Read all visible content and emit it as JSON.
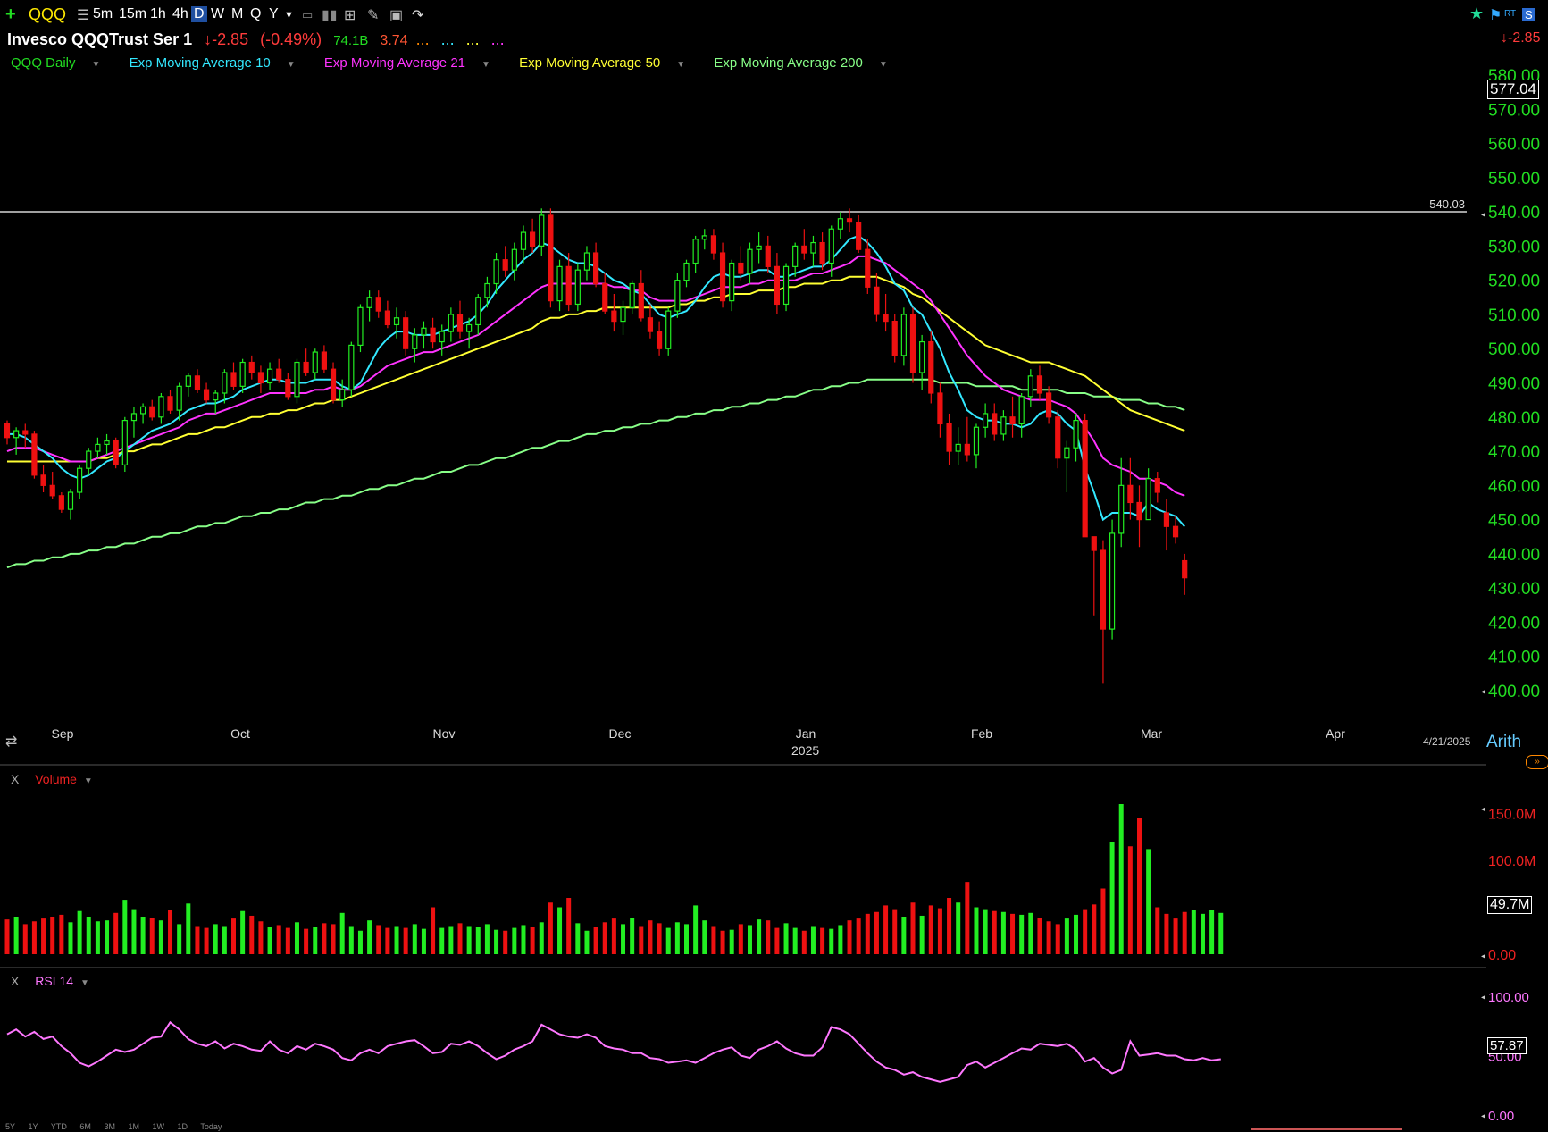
{
  "toolbar": {
    "symbol": "QQQ",
    "intervals": [
      "5m",
      "15m",
      "1h",
      "4h",
      "D",
      "W",
      "M",
      "Q",
      "Y"
    ],
    "active_interval": "D",
    "icons": [
      "add-symbol-icon",
      "list-icon",
      "template-icon",
      "bars-icon",
      "layout-icon",
      "draw-icon",
      "share-icon",
      "redo-icon"
    ],
    "right": {
      "star": "star-icon",
      "flag": "flag-icon",
      "rt": "RT",
      "s": "S"
    }
  },
  "header": {
    "name": "Invesco QQQTrust Ser 1",
    "change": "-2.85",
    "change_pct": "(-0.49%)",
    "mktcap": "74.1B",
    "value2": "3.74",
    "right_change": "-2.85"
  },
  "studies": [
    {
      "label": "QQQ Daily",
      "color": "#22dd22"
    },
    {
      "label": "Exp Moving Average 10",
      "color": "#33e8ff"
    },
    {
      "label": "Exp Moving Average 21",
      "color": "#ff33ff"
    },
    {
      "label": "Exp Moving Average 50",
      "color": "#ffff33"
    },
    {
      "label": "Exp Moving Average 200",
      "color": "#88ff88"
    }
  ],
  "price_axis": {
    "ticks": [
      "580.00",
      "570.00",
      "560.00",
      "550.00",
      "540.00",
      "530.00",
      "520.00",
      "510.00",
      "500.00",
      "490.00",
      "480.00",
      "470.00",
      "460.00",
      "450.00",
      "440.00",
      "430.00",
      "420.00",
      "410.00",
      "400.00"
    ],
    "last_price": "577.04",
    "scale": "Arith",
    "date": "4/21/2025"
  },
  "time_axis": {
    "labels": [
      "Sep",
      "Oct",
      "Nov",
      "Dec",
      "Jan",
      "Feb",
      "Mar",
      "Apr"
    ],
    "year": "2025"
  },
  "hline": {
    "value": 540.03,
    "label": "540.03"
  },
  "volume_panel": {
    "title": "Volume",
    "ticks": [
      "150.0M",
      "100.0M",
      "0.00"
    ],
    "last": "49.7M"
  },
  "rsi_panel": {
    "title": "RSI 14",
    "ticks": [
      "100.00",
      "50.00",
      "0.00"
    ],
    "last": "57.87"
  },
  "close_label": "X",
  "periods": [
    "5Y",
    "1Y",
    "YTD",
    "6M",
    "3M",
    "1M",
    "1W",
    "1D",
    "Today"
  ],
  "chart_data": {
    "type": "candlestick",
    "title": "QQQ Daily",
    "ylim": [
      400,
      580
    ],
    "first_date": "2024-08-26",
    "candles": [
      [
        478,
        479,
        472,
        474
      ],
      [
        474,
        477,
        469,
        476
      ],
      [
        476,
        478,
        471,
        475
      ],
      [
        475,
        476,
        462,
        463
      ],
      [
        463,
        466,
        458,
        460
      ],
      [
        460,
        464,
        456,
        457
      ],
      [
        457,
        458,
        452,
        453
      ],
      [
        453,
        459,
        450,
        458
      ],
      [
        458,
        466,
        456,
        465
      ],
      [
        465,
        471,
        463,
        470
      ],
      [
        470,
        474,
        468,
        472
      ],
      [
        472,
        475,
        469,
        473
      ],
      [
        473,
        474,
        465,
        466
      ],
      [
        466,
        480,
        464,
        479
      ],
      [
        479,
        483,
        474,
        481
      ],
      [
        481,
        484,
        478,
        483
      ],
      [
        483,
        485,
        479,
        480
      ],
      [
        480,
        487,
        478,
        486
      ],
      [
        486,
        488,
        481,
        482
      ],
      [
        482,
        490,
        479,
        489
      ],
      [
        489,
        493,
        486,
        492
      ],
      [
        492,
        494,
        487,
        488
      ],
      [
        488,
        490,
        484,
        485
      ],
      [
        485,
        488,
        481,
        487
      ],
      [
        487,
        494,
        484,
        493
      ],
      [
        493,
        496,
        488,
        489
      ],
      [
        489,
        497,
        487,
        496
      ],
      [
        496,
        498,
        491,
        493
      ],
      [
        493,
        495,
        487,
        490
      ],
      [
        490,
        496,
        488,
        494
      ],
      [
        494,
        497,
        490,
        491
      ],
      [
        491,
        493,
        485,
        486
      ],
      [
        486,
        497,
        484,
        496
      ],
      [
        496,
        500,
        492,
        493
      ],
      [
        493,
        500,
        491,
        499
      ],
      [
        499,
        501,
        493,
        494
      ],
      [
        494,
        496,
        484,
        485
      ],
      [
        485,
        491,
        483,
        488
      ],
      [
        488,
        502,
        486,
        501
      ],
      [
        501,
        513,
        499,
        512
      ],
      [
        512,
        517,
        508,
        515
      ],
      [
        515,
        517,
        509,
        511
      ],
      [
        511,
        514,
        506,
        507
      ],
      [
        507,
        512,
        503,
        509
      ],
      [
        509,
        511,
        498,
        500
      ],
      [
        500,
        506,
        496,
        504
      ],
      [
        504,
        508,
        500,
        506
      ],
      [
        506,
        509,
        500,
        502
      ],
      [
        502,
        507,
        498,
        505
      ],
      [
        505,
        512,
        502,
        510
      ],
      [
        510,
        514,
        503,
        505
      ],
      [
        505,
        509,
        500,
        507
      ],
      [
        507,
        516,
        504,
        515
      ],
      [
        515,
        521,
        512,
        519
      ],
      [
        519,
        528,
        516,
        526
      ],
      [
        526,
        530,
        521,
        523
      ],
      [
        523,
        531,
        520,
        529
      ],
      [
        529,
        536,
        525,
        534
      ],
      [
        534,
        538,
        528,
        530
      ],
      [
        530,
        541,
        527,
        539
      ],
      [
        539,
        541,
        512,
        514
      ],
      [
        514,
        526,
        511,
        524
      ],
      [
        524,
        528,
        511,
        513
      ],
      [
        513,
        525,
        511,
        523
      ],
      [
        523,
        530,
        520,
        528
      ],
      [
        528,
        531,
        518,
        519
      ],
      [
        519,
        522,
        510,
        511
      ],
      [
        511,
        516,
        505,
        508
      ],
      [
        508,
        514,
        504,
        512
      ],
      [
        512,
        520,
        510,
        519
      ],
      [
        519,
        523,
        508,
        509
      ],
      [
        509,
        513,
        503,
        505
      ],
      [
        505,
        508,
        498,
        500
      ],
      [
        500,
        512,
        498,
        511
      ],
      [
        511,
        522,
        509,
        520
      ],
      [
        520,
        526,
        518,
        525
      ],
      [
        525,
        533,
        522,
        532
      ],
      [
        532,
        535,
        529,
        533
      ],
      [
        533,
        535,
        526,
        528
      ],
      [
        528,
        531,
        512,
        514
      ],
      [
        514,
        526,
        511,
        525
      ],
      [
        525,
        530,
        520,
        522
      ],
      [
        522,
        531,
        519,
        529
      ],
      [
        529,
        534,
        525,
        530
      ],
      [
        530,
        533,
        522,
        524
      ],
      [
        524,
        528,
        510,
        513
      ],
      [
        513,
        525,
        511,
        524
      ],
      [
        524,
        531,
        521,
        530
      ],
      [
        530,
        535,
        526,
        528
      ],
      [
        528,
        533,
        524,
        531
      ],
      [
        531,
        534,
        523,
        525
      ],
      [
        525,
        536,
        521,
        535
      ],
      [
        535,
        540,
        532,
        538
      ],
      [
        538,
        541,
        534,
        537
      ],
      [
        537,
        539,
        528,
        529
      ],
      [
        529,
        532,
        516,
        518
      ],
      [
        518,
        522,
        508,
        510
      ],
      [
        510,
        516,
        505,
        508
      ],
      [
        508,
        510,
        496,
        498
      ],
      [
        498,
        512,
        495,
        510
      ],
      [
        510,
        512,
        490,
        493
      ],
      [
        493,
        504,
        488,
        502
      ],
      [
        502,
        505,
        484,
        487
      ],
      [
        487,
        490,
        474,
        478
      ],
      [
        478,
        481,
        466,
        470
      ],
      [
        470,
        477,
        466,
        472
      ],
      [
        472,
        480,
        467,
        469
      ],
      [
        469,
        478,
        465,
        477
      ],
      [
        477,
        484,
        474,
        481
      ],
      [
        481,
        484,
        473,
        475
      ],
      [
        475,
        482,
        473,
        480
      ],
      [
        480,
        486,
        474,
        478
      ],
      [
        478,
        487,
        474,
        486
      ],
      [
        486,
        494,
        483,
        492
      ],
      [
        492,
        495,
        485,
        487
      ],
      [
        487,
        489,
        478,
        480
      ],
      [
        480,
        482,
        465,
        468
      ],
      [
        468,
        473,
        458,
        471
      ],
      [
        471,
        481,
        467,
        479
      ],
      [
        479,
        481,
        460,
        445
      ],
      [
        445,
        441,
        422,
        441
      ],
      [
        441,
        444,
        402,
        418
      ],
      [
        418,
        450,
        415,
        446
      ],
      [
        446,
        468,
        442,
        460
      ],
      [
        460,
        468,
        450,
        455
      ],
      [
        455,
        460,
        442,
        450
      ],
      [
        450,
        465,
        450,
        462
      ],
      [
        462,
        464,
        455,
        458
      ],
      [
        452,
        456,
        441,
        448
      ],
      [
        448,
        451,
        443,
        445
      ],
      [
        438,
        440,
        428,
        433
      ]
    ],
    "volume_ylim": [
      0,
      160
    ],
    "volume": [
      37,
      40,
      32,
      35,
      38,
      40,
      42,
      34,
      46,
      40,
      35,
      36,
      44,
      58,
      48,
      40,
      39,
      36,
      47,
      32,
      54,
      30,
      28,
      32,
      30,
      38,
      46,
      41,
      35,
      29,
      31,
      28,
      34,
      27,
      29,
      33,
      32,
      44,
      30,
      25,
      36,
      31,
      28,
      30,
      28,
      32,
      27,
      50,
      28,
      30,
      33,
      30,
      29,
      32,
      26,
      25,
      28,
      31,
      29,
      34,
      55,
      50,
      60,
      33,
      25,
      29,
      34,
      38,
      32,
      39,
      30,
      36,
      33,
      28,
      34,
      32,
      52,
      36,
      30,
      25,
      26,
      32,
      31,
      37,
      36,
      28,
      33,
      28,
      25,
      30,
      28,
      27,
      31,
      36,
      38,
      43,
      45,
      52,
      48,
      40,
      55,
      41,
      52,
      49,
      60,
      55,
      77,
      50,
      48,
      46,
      45,
      43,
      42,
      44,
      39,
      35,
      32,
      38,
      42,
      48,
      53,
      70,
      120,
      160,
      115,
      145,
      112,
      50,
      43,
      38,
      45,
      47,
      43,
      47,
      44
    ],
    "rsi": [
      68,
      72,
      66,
      70,
      64,
      66,
      58,
      52,
      44,
      41,
      45,
      50,
      55,
      53,
      55,
      60,
      65,
      66,
      78,
      72,
      64,
      60,
      58,
      62,
      56,
      60,
      58,
      55,
      54,
      62,
      55,
      52,
      58,
      55,
      60,
      58,
      55,
      48,
      46,
      52,
      55,
      52,
      58,
      60,
      62,
      63,
      58,
      52,
      53,
      60,
      59,
      62,
      58,
      52,
      47,
      50,
      55,
      58,
      62,
      76,
      72,
      68,
      66,
      65,
      68,
      65,
      58,
      56,
      55,
      52,
      52,
      48,
      47,
      44,
      45,
      46,
      44,
      48,
      52,
      55,
      57,
      50,
      48,
      55,
      58,
      62,
      56,
      52,
      50,
      50,
      57,
      74,
      72,
      68,
      60,
      52,
      45,
      40,
      38,
      34,
      36,
      32,
      30,
      28,
      30,
      32,
      42,
      45,
      40,
      44,
      48,
      52,
      56,
      55,
      60,
      59,
      58,
      60,
      55,
      45,
      48,
      40,
      35,
      38,
      62,
      50,
      51,
      52,
      50,
      50,
      47,
      46,
      48,
      46,
      47
    ],
    "ema10": [
      475,
      475,
      474,
      472,
      470,
      468,
      465,
      463,
      462,
      463,
      465,
      467,
      468,
      470,
      472,
      474,
      476,
      477,
      478,
      480,
      482,
      483,
      484,
      484,
      485,
      486,
      488,
      489,
      490,
      491,
      491,
      490,
      490,
      490,
      491,
      491,
      491,
      489,
      488,
      490,
      495,
      500,
      503,
      505,
      505,
      504,
      504,
      504,
      505,
      506,
      507,
      508,
      510,
      513,
      517,
      520,
      523,
      526,
      528,
      531,
      530,
      528,
      526,
      525,
      525,
      524,
      522,
      520,
      519,
      517,
      516,
      513,
      510,
      509,
      510,
      511,
      514,
      518,
      521,
      522,
      521,
      521,
      522,
      523,
      523,
      521,
      521,
      522,
      523,
      524,
      524,
      526,
      529,
      532,
      533,
      531,
      528,
      524,
      519,
      517,
      512,
      510,
      505,
      500,
      493,
      488,
      482,
      480,
      479,
      479,
      478,
      478,
      477,
      478,
      481,
      482,
      481,
      478,
      476,
      465,
      458,
      450,
      452,
      452,
      452,
      451,
      455,
      453,
      452,
      451,
      448
    ],
    "ema21": [
      470,
      471,
      471,
      471,
      470,
      469,
      468,
      467,
      467,
      467,
      468,
      469,
      470,
      471,
      472,
      473,
      474,
      475,
      476,
      477,
      479,
      480,
      481,
      481,
      482,
      483,
      484,
      485,
      486,
      487,
      487,
      487,
      487,
      487,
      488,
      488,
      489,
      488,
      488,
      489,
      491,
      493,
      495,
      496,
      497,
      498,
      499,
      499,
      500,
      501,
      502,
      503,
      504,
      506,
      508,
      510,
      512,
      514,
      516,
      518,
      519,
      519,
      519,
      519,
      519,
      519,
      519,
      518,
      518,
      517,
      517,
      515,
      514,
      514,
      514,
      514,
      515,
      516,
      517,
      518,
      518,
      518,
      519,
      519,
      520,
      520,
      520,
      520,
      521,
      522,
      522,
      523,
      524,
      525,
      527,
      527,
      526,
      525,
      523,
      521,
      519,
      517,
      514,
      510,
      506,
      502,
      498,
      495,
      492,
      490,
      488,
      487,
      486,
      485,
      485,
      485,
      484,
      483,
      481,
      477,
      473,
      468,
      466,
      465,
      464,
      462,
      462,
      461,
      460,
      458,
      457
    ],
    "ema50": [
      467,
      467,
      467,
      467,
      467,
      467,
      467,
      467,
      467,
      467,
      468,
      468,
      469,
      470,
      470,
      471,
      472,
      472,
      473,
      474,
      475,
      475,
      476,
      477,
      477,
      478,
      479,
      480,
      480,
      481,
      481,
      482,
      482,
      483,
      484,
      484,
      485,
      485,
      486,
      487,
      488,
      489,
      490,
      491,
      492,
      493,
      494,
      495,
      496,
      497,
      498,
      499,
      500,
      501,
      502,
      503,
      504,
      505,
      506,
      508,
      509,
      509,
      510,
      510,
      511,
      511,
      512,
      512,
      512,
      512,
      512,
      512,
      512,
      512,
      513,
      513,
      514,
      514,
      515,
      515,
      516,
      516,
      516,
      517,
      517,
      517,
      518,
      518,
      519,
      519,
      519,
      520,
      520,
      521,
      521,
      521,
      521,
      520,
      519,
      518,
      516,
      515,
      513,
      511,
      509,
      507,
      505,
      503,
      501,
      500,
      499,
      498,
      497,
      496,
      496,
      496,
      495,
      494,
      493,
      492,
      490,
      488,
      486,
      484,
      482,
      481,
      480,
      479,
      478,
      477,
      476
    ],
    "ema200": [
      436,
      437,
      437,
      438,
      438,
      439,
      439,
      440,
      440,
      441,
      441,
      442,
      442,
      443,
      443,
      444,
      445,
      445,
      446,
      446,
      447,
      448,
      448,
      449,
      449,
      450,
      451,
      451,
      452,
      452,
      453,
      453,
      454,
      455,
      455,
      456,
      456,
      457,
      457,
      458,
      459,
      459,
      460,
      460,
      461,
      462,
      462,
      463,
      464,
      464,
      465,
      466,
      466,
      467,
      468,
      468,
      469,
      470,
      471,
      471,
      472,
      473,
      473,
      474,
      475,
      475,
      476,
      476,
      477,
      477,
      478,
      478,
      479,
      479,
      480,
      480,
      481,
      481,
      482,
      482,
      483,
      483,
      484,
      484,
      485,
      485,
      486,
      486,
      487,
      488,
      488,
      489,
      489,
      490,
      490,
      491,
      491,
      491,
      491,
      491,
      491,
      491,
      491,
      490,
      490,
      490,
      490,
      489,
      489,
      489,
      489,
      489,
      488,
      488,
      488,
      488,
      488,
      487,
      487,
      487,
      486,
      486,
      486,
      485,
      485,
      485,
      484,
      484,
      483,
      483,
      482
    ]
  }
}
